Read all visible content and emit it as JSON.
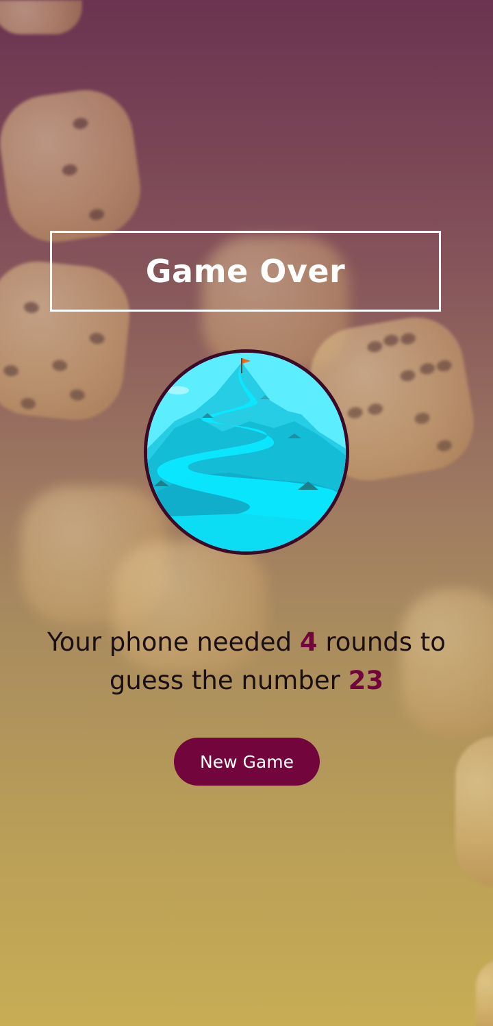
{
  "screen": {
    "title": "Game Over",
    "image_alt": "mountain-summit-illustration",
    "summary": {
      "part1": "Your phone needed ",
      "rounds": "4",
      "part2": " rounds to guess the number ",
      "number": "23"
    },
    "button_label": "New Game"
  },
  "colors": {
    "accent": "#72063c",
    "badge_border": "#3c0a26",
    "title_border": "#ffffff",
    "text": "#1a0f12"
  }
}
